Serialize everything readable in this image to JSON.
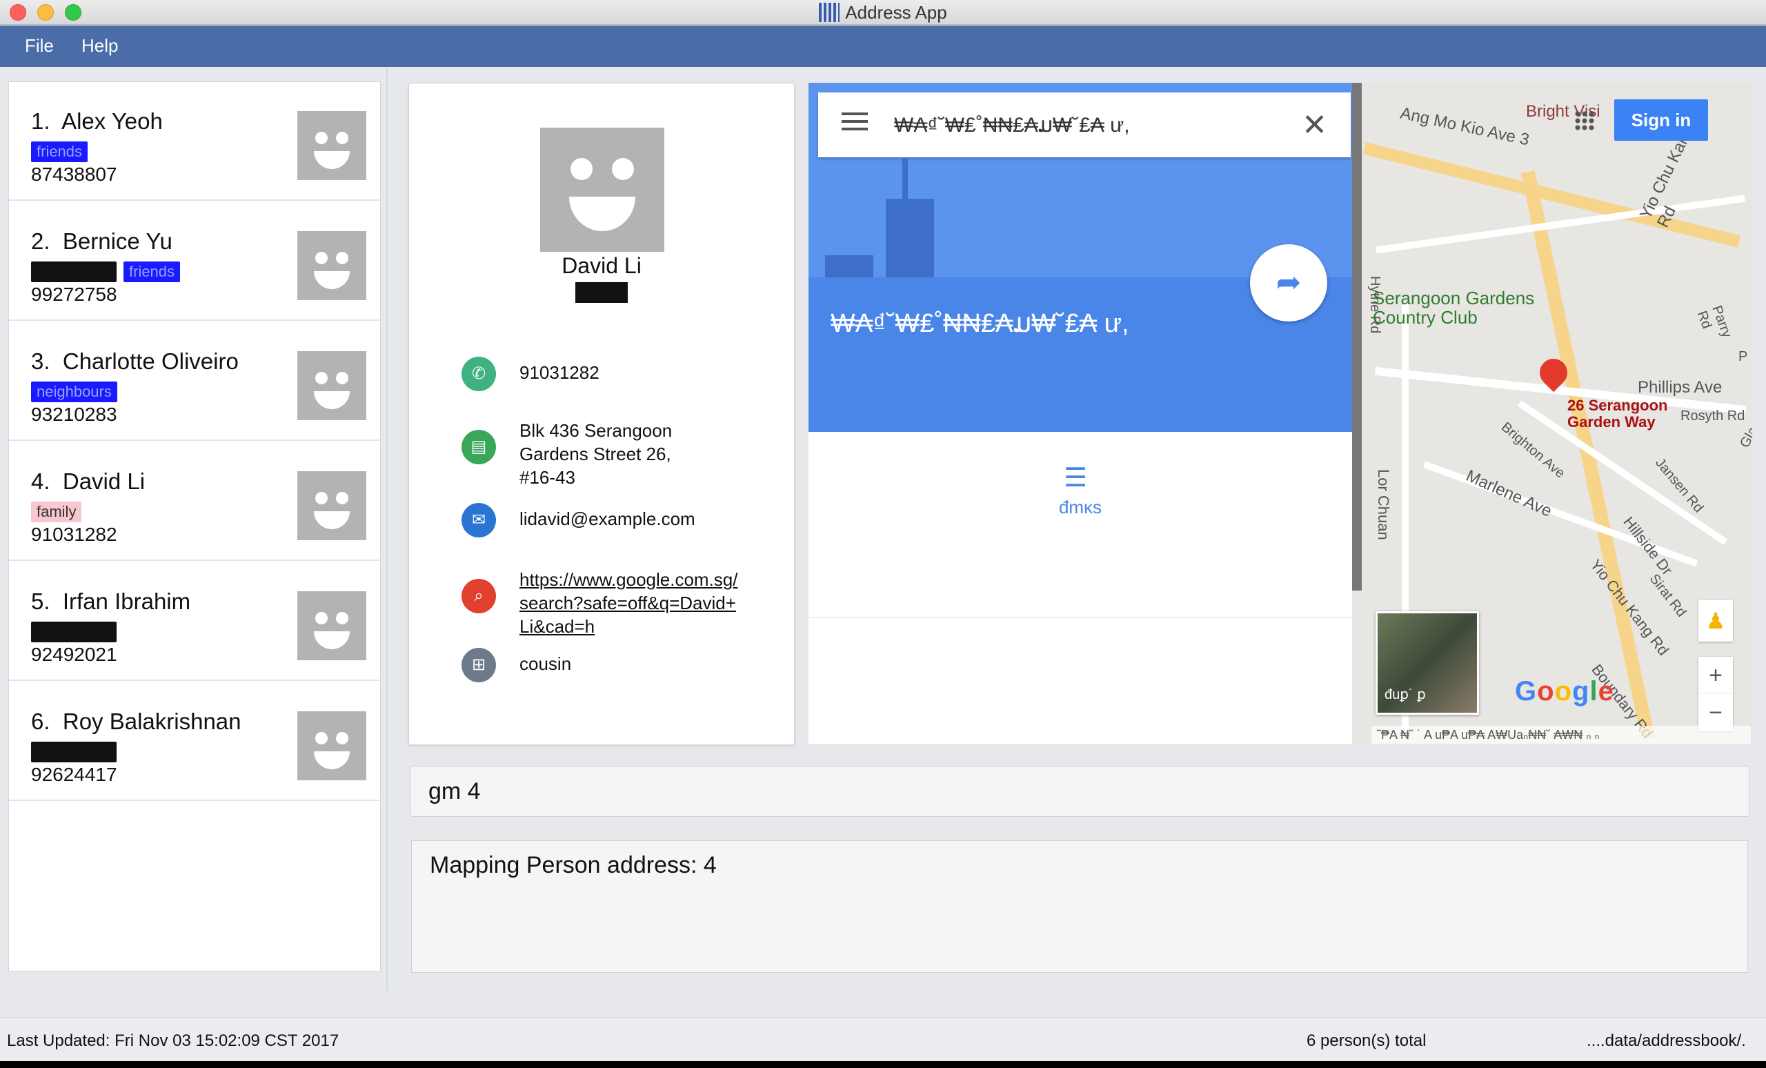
{
  "window": {
    "title": "Address App"
  },
  "menu": {
    "items": [
      "File",
      "Help"
    ]
  },
  "persons": [
    {
      "index": "1.",
      "name": "Alex Yeoh",
      "tags": [
        {
          "label": "friends",
          "style": "blue"
        }
      ],
      "phone": "87438807"
    },
    {
      "index": "2.",
      "name": "Bernice Yu",
      "tags": [
        {
          "label": "",
          "style": "black"
        },
        {
          "label": "friends",
          "style": "blue"
        }
      ],
      "phone": "99272758"
    },
    {
      "index": "3.",
      "name": "Charlotte Oliveiro",
      "tags": [
        {
          "label": "neighbours",
          "style": "blue"
        }
      ],
      "phone": "93210283"
    },
    {
      "index": "4.",
      "name": "David Li",
      "tags": [
        {
          "label": "family",
          "style": "pink"
        }
      ],
      "phone": "91031282"
    },
    {
      "index": "5.",
      "name": "Irfan Ibrahim",
      "tags": [
        {
          "label": "",
          "style": "black"
        }
      ],
      "phone": "92492021"
    },
    {
      "index": "6.",
      "name": "Roy Balakrishnan",
      "tags": [
        {
          "label": "",
          "style": "black"
        }
      ],
      "phone": "92624417"
    }
  ],
  "detail": {
    "name": "David Li",
    "phone": "91031282",
    "address": "Blk 436 Serangoon Gardens Street 26, #16-43",
    "email": "lidavid@example.com",
    "url": "https://www.google.com.sg/search?safe=off&q=David+Li&cad=h",
    "relationship": "cousin",
    "icons": [
      "phone-icon",
      "address-icon",
      "email-icon",
      "search-icon",
      "relationship-icon"
    ],
    "icon_colors": [
      "#3fb27f",
      "#3aa65a",
      "#2a74d4",
      "#e2402f",
      "#6c7a8a"
    ]
  },
  "map": {
    "search_query": "₩₳₫˘₩₤˚₦₦₤₳ມ₩˘₤₳ ư,",
    "place_title": "₩₳₫˘₩₤˚₦₦₤₳ມ₩˘₤₳ ư,",
    "strip_label": "đmĸs",
    "sign_in": "Sign in",
    "pin_label": "26 Serangoon Garden Way",
    "satellite_label": "đuꝑ˙ ꝑ",
    "footer": "˜₱A ₦˘ ˙ A u₱A u₱₳ A₩Uaₙ₦₦˘ ₳₩₦ ₙ ₙ",
    "logo": "Google",
    "labels": [
      "Ang Mo Kio Ave 3",
      "Bright Visi",
      "Yio Chu Kang Rd",
      "Hythe Rd",
      "Serangoon Gardens Country Club",
      "Phillips Ave",
      "Rosyth Rd",
      "Brighton Ave",
      "Marlene Ave",
      "Lor Chuan",
      "Jansen Rd",
      "Hillside Dr",
      "Sirat Rd",
      "Yio Chu Kang Rd",
      "Boundary Rd",
      "Parry Rd",
      "Glas",
      "P"
    ]
  },
  "command": {
    "value": "gm 4"
  },
  "result": {
    "text": "Mapping Person address: 4"
  },
  "status": {
    "last_updated": "Last Updated: Fri Nov 03 15:02:09 CST 2017",
    "total": "6 person(s) total",
    "path": "....data/addressbook/."
  }
}
